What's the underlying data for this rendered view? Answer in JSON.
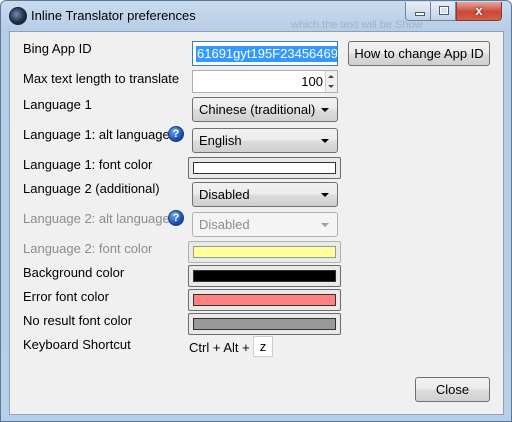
{
  "window": {
    "title": "Inline Translator preferences",
    "background_ghost_text": "which the text will be   Show",
    "close_glyph": "x"
  },
  "form": {
    "app_id": {
      "label": "Bing App ID",
      "value": "61691gyt195F23456469",
      "help_button": "How to change App ID"
    },
    "max_length": {
      "label": "Max text length to translate",
      "value": "100"
    },
    "language1": {
      "label": "Language 1",
      "selected": "Chinese (traditional)"
    },
    "language1_alt": {
      "label": "Language 1: alt language",
      "selected": "English",
      "help_icon": "?"
    },
    "language1_font": {
      "label": "Language 1: font color",
      "color": "#ffffff"
    },
    "language2": {
      "label": "Language 2 (additional)",
      "selected": "Disabled"
    },
    "language2_alt": {
      "label": "Language 2: alt language",
      "selected": "Disabled",
      "help_icon": "?"
    },
    "language2_font": {
      "label": "Language 2: font color",
      "color": "#ffff99"
    },
    "background": {
      "label": "Background color",
      "color": "#000000"
    },
    "error_font": {
      "label": "Error font color",
      "color": "#ff8080"
    },
    "no_result_font": {
      "label": "No result font color",
      "color": "#999999"
    },
    "shortcut": {
      "label": "Keyboard Shortcut",
      "modifiers": "Ctrl + Alt +",
      "key": "z"
    }
  },
  "buttons": {
    "close": "Close"
  }
}
